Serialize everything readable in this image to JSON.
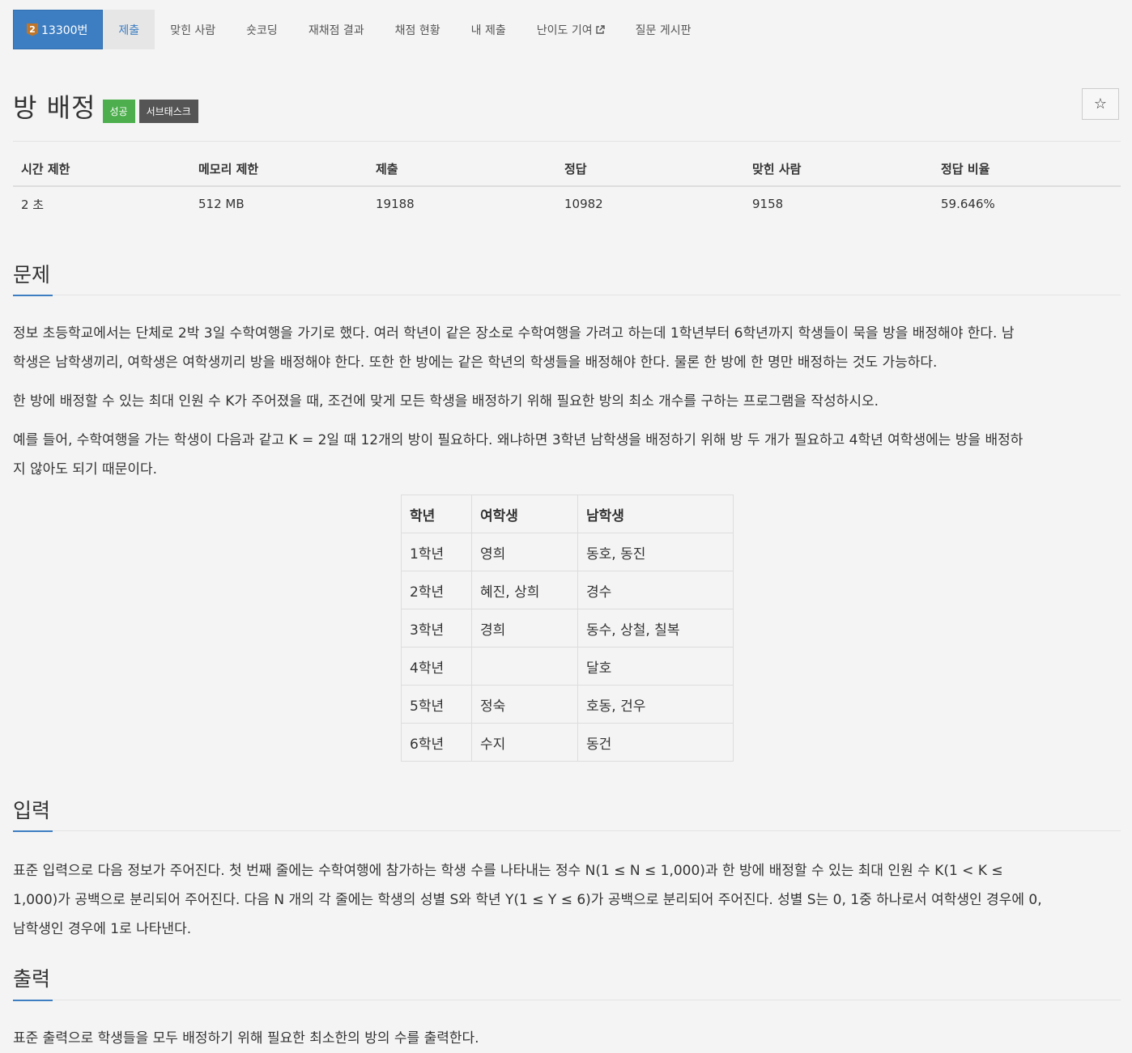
{
  "nav": {
    "problem_badge": "2",
    "problem_number": "13300번",
    "tabs": [
      "제출",
      "맞힌 사람",
      "숏코딩",
      "재채점 결과",
      "채점 현황",
      "내 제출",
      "난이도 기여",
      "질문 게시판"
    ]
  },
  "problem": {
    "title": "방 배정",
    "labels": [
      "성공",
      "서브태스크"
    ],
    "star": "☆"
  },
  "stats": {
    "headers": [
      "시간 제한",
      "메모리 제한",
      "제출",
      "정답",
      "맞힌 사람",
      "정답 비율"
    ],
    "values": [
      "2 초",
      "512 MB",
      "19188",
      "10982",
      "9158",
      "59.646%"
    ]
  },
  "sections": {
    "problem_head": "문제",
    "problem_p1_l1": "정보 초등학교에서는 단체로 2박 3일 수학여행을 가기로 했다. 여러 학년이 같은 장소로 수학여행을 가려고 하는데 1학년부터 6학년까지 학생들이 묵을 방을 배정해야 한다. 남",
    "problem_p1_l2": "학생은 남학생끼리, 여학생은 여학생끼리 방을 배정해야 한다. 또한 한 방에는 같은 학년의 학생들을 배정해야 한다. 물론 한 방에 한 명만 배정하는 것도 가능하다.",
    "problem_p2": "한 방에 배정할 수 있는 최대 인원 수 K가 주어졌을 때, 조건에 맞게 모든 학생을 배정하기 위해 필요한 방의 최소 개수를 구하는 프로그램을 작성하시오.",
    "problem_p3_l1": "예를 들어, 수학여행을 가는 학생이 다음과 같고 K = 2일 때 12개의 방이 필요하다. 왜냐하면 3학년 남학생을 배정하기 위해 방 두 개가 필요하고 4학년 여학생에는 방을 배정하",
    "problem_p3_l2": "지 않아도 되기 때문이다.",
    "input_head": "입력",
    "input_l1": "표준 입력으로 다음 정보가 주어진다. 첫 번째 줄에는 수학여행에 참가하는 학생 수를 나타내는 정수 N(1 ≤ N ≤ 1,000)과 한 방에 배정할 수 있는 최대 인원 수 K(1 < K ≤",
    "input_l2": "1,000)가 공백으로 분리되어 주어진다. 다음 N 개의 각 줄에는 학생의 성별 S와 학년 Y(1 ≤ Y ≤ 6)가 공백으로 분리되어 주어진다. 성별 S는 0, 1중 하나로서 여학생인 경우에 0,",
    "input_l3": "남학생인 경우에 1로 나타낸다.",
    "output_head": "출력",
    "output_l1": "표준 출력으로 학생들을 모두 배정하기 위해 필요한 최소한의 방의 수를 출력한다."
  },
  "table": {
    "headers": [
      "학년",
      "여학생",
      "남학생"
    ],
    "rows": [
      [
        "1학년",
        "영희",
        "동호, 동진"
      ],
      [
        "2학년",
        "혜진, 상희",
        "경수"
      ],
      [
        "3학년",
        "경희",
        "동수, 상철, 칠복"
      ],
      [
        "4학년",
        "",
        "달호"
      ],
      [
        "5학년",
        "정숙",
        "호동, 건우"
      ],
      [
        "6학년",
        "수지",
        "동건"
      ]
    ]
  }
}
